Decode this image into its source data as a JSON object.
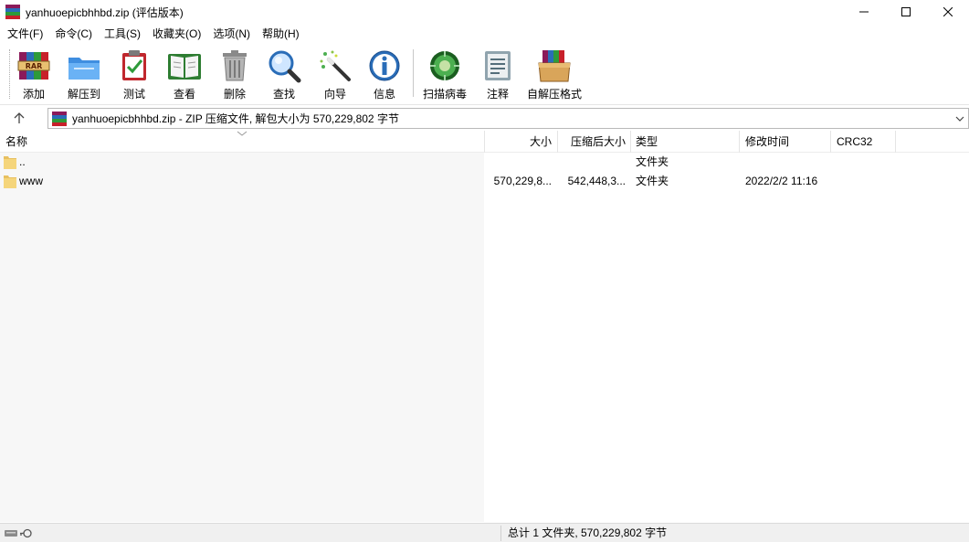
{
  "window": {
    "title": "yanhuoepicbhhbd.zip (评估版本)",
    "minimize_label": "—",
    "maximize_label": "☐",
    "close_label": "✕"
  },
  "menu": [
    {
      "label": "文件(F)"
    },
    {
      "label": "命令(C)"
    },
    {
      "label": "工具(S)"
    },
    {
      "label": "收藏夹(O)"
    },
    {
      "label": "选项(N)"
    },
    {
      "label": "帮助(H)"
    }
  ],
  "toolbar": {
    "buttons": [
      {
        "label": "添加",
        "icon": "rar-books-icon"
      },
      {
        "label": "解压到",
        "icon": "folder-extract-icon"
      },
      {
        "label": "测试",
        "icon": "clipboard-check-icon"
      },
      {
        "label": "查看",
        "icon": "open-book-icon"
      },
      {
        "label": "删除",
        "icon": "trash-can-icon"
      },
      {
        "label": "查找",
        "icon": "magnifier-icon"
      },
      {
        "label": "向导",
        "icon": "magic-wand-icon"
      },
      {
        "label": "信息",
        "icon": "info-icon"
      },
      {
        "label": "扫描病毒",
        "icon": "virus-scan-icon"
      },
      {
        "label": "注释",
        "icon": "comment-icon"
      },
      {
        "label": "自解压格式",
        "icon": "sfx-box-icon"
      }
    ]
  },
  "address": {
    "up_label": "↑",
    "path": "yanhuoepicbhhbd.zip - ZIP 压缩文件, 解包大小为 570,229,802 字节"
  },
  "columns": {
    "name": "名称",
    "size": "大小",
    "packed": "压缩后大小",
    "type": "类型",
    "modified": "修改时间",
    "crc": "CRC32"
  },
  "rows": [
    {
      "name": "..",
      "size": "",
      "packed": "",
      "type": "文件夹",
      "modified": "",
      "crc": ""
    },
    {
      "name": "www",
      "size": "570,229,8...",
      "packed": "542,448,3...",
      "type": "文件夹",
      "modified": "2022/2/2 11:16",
      "crc": ""
    }
  ],
  "status": {
    "summary": "总计 1 文件夹, 570,229,802 字节"
  },
  "colors": {
    "folder": "#f5d57b",
    "name_column_bg": "#f7f7f7",
    "statusbar_bg": "#f0f0f0"
  }
}
